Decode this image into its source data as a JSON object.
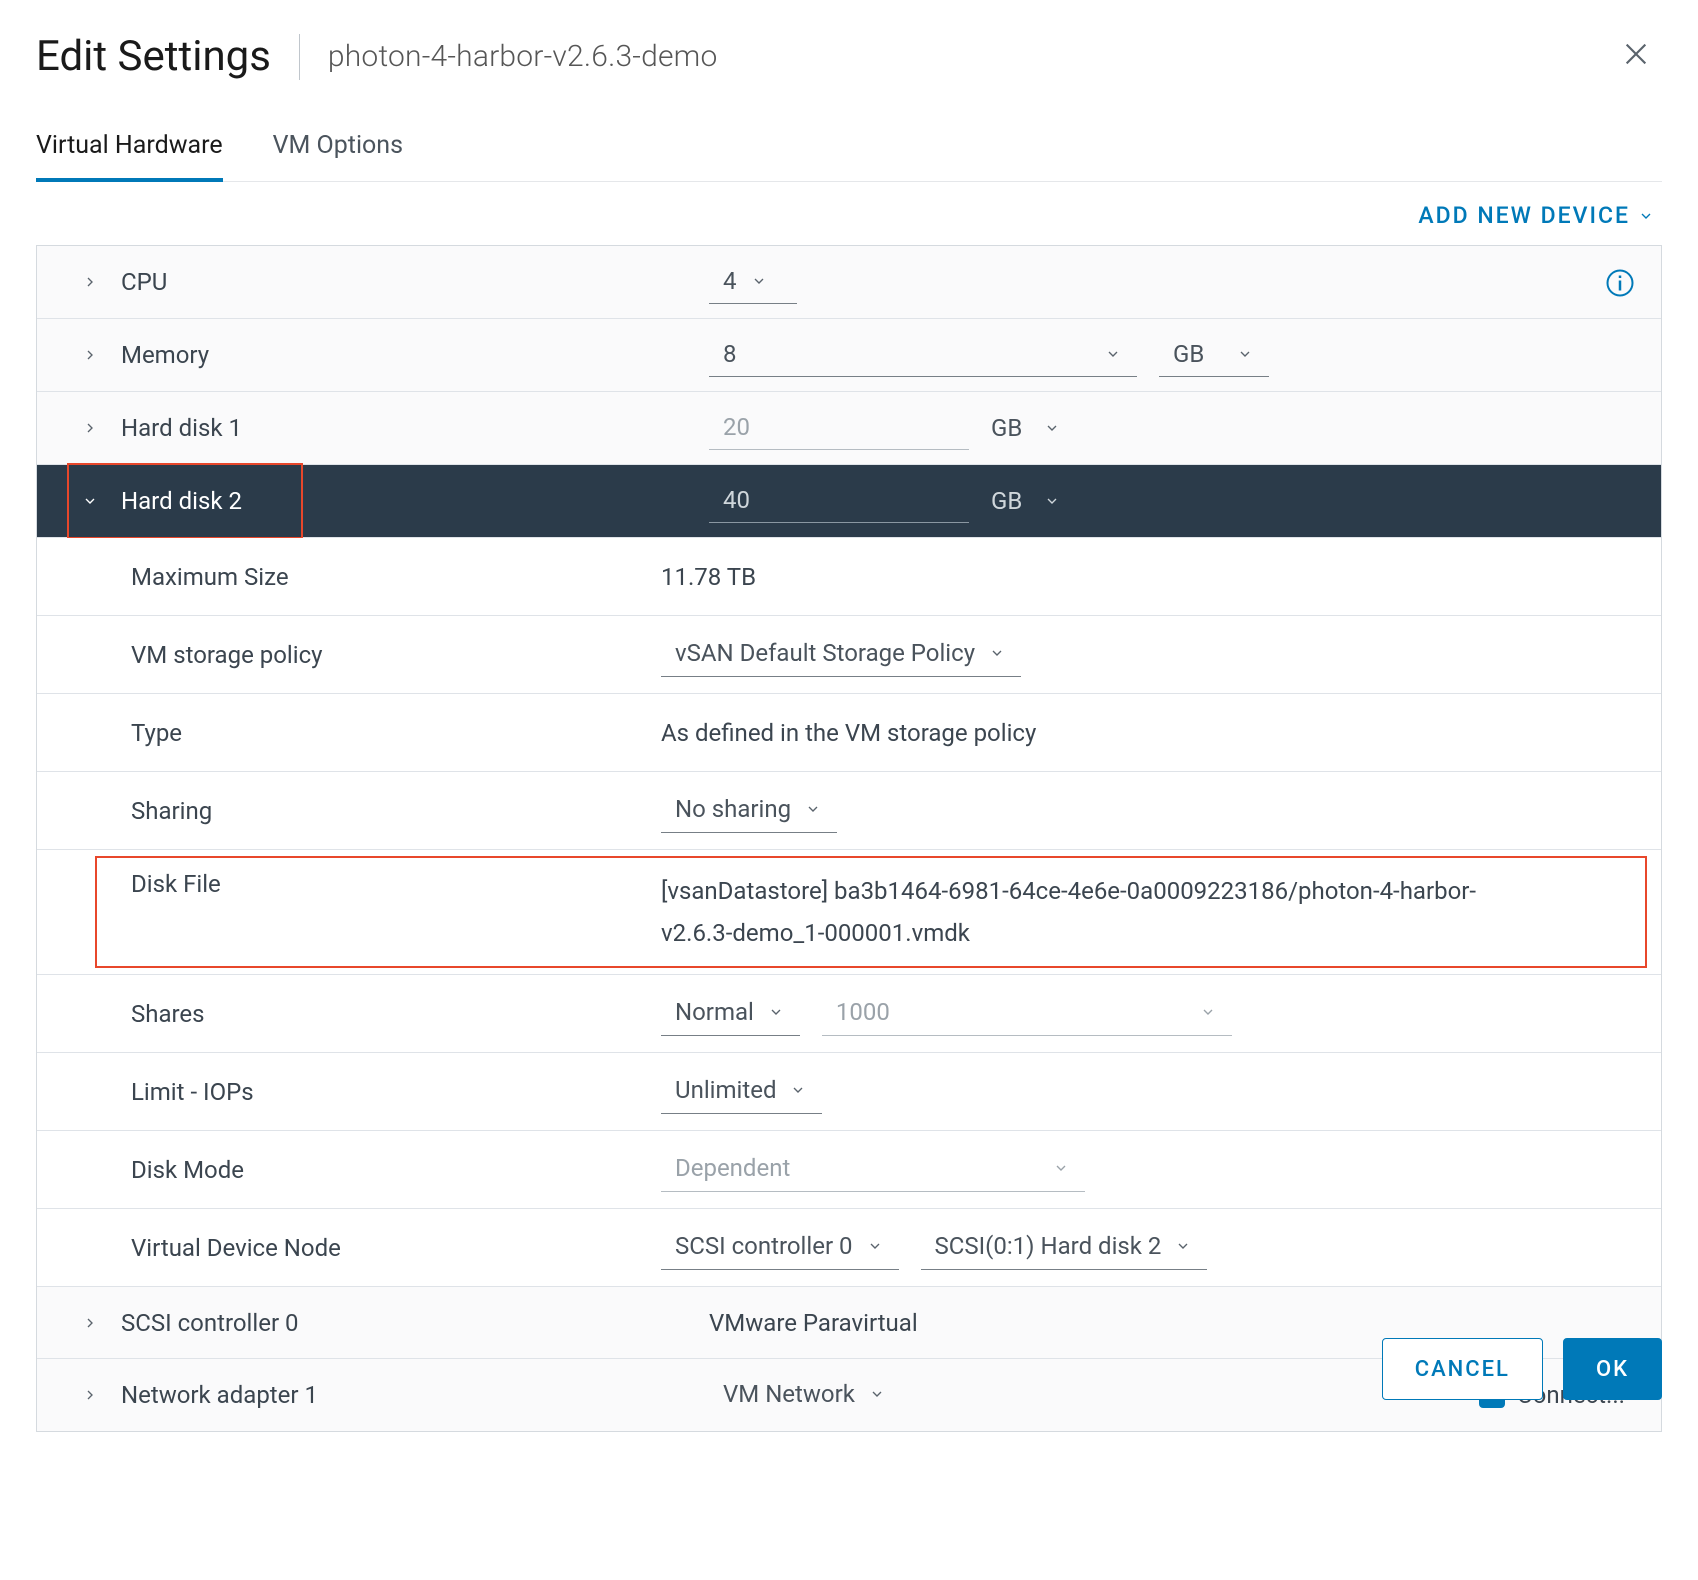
{
  "header": {
    "title": "Edit Settings",
    "subtitle": "photon-4-harbor-v2.6.3-demo"
  },
  "tabs": {
    "virtual_hardware": "Virtual Hardware",
    "vm_options": "VM Options"
  },
  "toolbar": {
    "add_new_device": "ADD NEW DEVICE"
  },
  "rows": {
    "cpu": {
      "label": "CPU",
      "value": "4"
    },
    "memory": {
      "label": "Memory",
      "value": "8",
      "unit": "GB"
    },
    "hd1": {
      "label": "Hard disk 1",
      "value": "20",
      "unit": "GB"
    },
    "hd2": {
      "label": "Hard disk 2",
      "value": "40",
      "unit": "GB",
      "max_size_label": "Maximum Size",
      "max_size_value": "11.78 TB",
      "storage_policy_label": "VM storage policy",
      "storage_policy_value": "vSAN Default Storage Policy",
      "type_label": "Type",
      "type_value": "As defined in the VM storage policy",
      "sharing_label": "Sharing",
      "sharing_value": "No sharing",
      "disk_file_label": "Disk File",
      "disk_file_value": "[vsanDatastore] ba3b1464-6981-64ce-4e6e-0a0009223186/photon-4-harbor-v2.6.3-demo_1-000001.vmdk",
      "shares_label": "Shares",
      "shares_value": "Normal",
      "shares_num": "1000",
      "limit_label": "Limit - IOPs",
      "limit_value": "Unlimited",
      "disk_mode_label": "Disk Mode",
      "disk_mode_value": "Dependent",
      "vdn_label": "Virtual Device Node",
      "vdn_controller": "SCSI controller 0",
      "vdn_slot": "SCSI(0:1) Hard disk 2"
    },
    "scsi": {
      "label": "SCSI controller 0",
      "value": "VMware Paravirtual"
    },
    "net": {
      "label": "Network adapter 1",
      "value": "VM Network",
      "connect": "Connect..."
    }
  },
  "footer": {
    "cancel": "CANCEL",
    "ok": "OK"
  }
}
